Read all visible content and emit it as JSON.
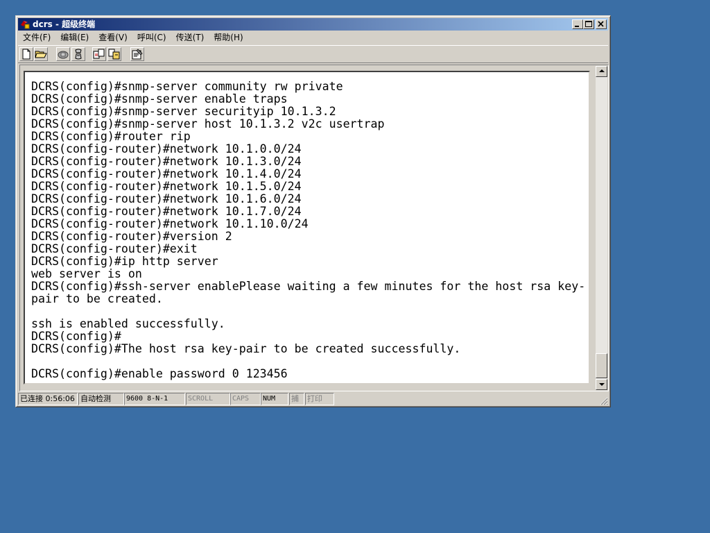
{
  "window": {
    "title": "dcrs - 超级终端"
  },
  "menu": [
    {
      "label": "文件(F)"
    },
    {
      "label": "编辑(E)"
    },
    {
      "label": "查看(V)"
    },
    {
      "label": "呼叫(C)"
    },
    {
      "label": "传送(T)"
    },
    {
      "label": "帮助(H)"
    }
  ],
  "toolbar": [
    {
      "icon": "new-file-icon"
    },
    {
      "icon": "open-folder-icon"
    },
    {
      "icon": "phone-icon"
    },
    {
      "icon": "disconnect-icon"
    },
    {
      "icon": "send-file-icon"
    },
    {
      "icon": "receive-file-icon"
    },
    {
      "icon": "properties-icon"
    }
  ],
  "terminal": {
    "lines": [
      "DCRS(config)#snmp-server community rw private",
      "DCRS(config)#snmp-server enable traps",
      "DCRS(config)#snmp-server securityip 10.1.3.2",
      "DCRS(config)#snmp-server host 10.1.3.2 v2c usertrap",
      "DCRS(config)#router rip",
      "DCRS(config-router)#network 10.1.0.0/24",
      "DCRS(config-router)#network 10.1.3.0/24",
      "DCRS(config-router)#network 10.1.4.0/24",
      "DCRS(config-router)#network 10.1.5.0/24",
      "DCRS(config-router)#network 10.1.6.0/24",
      "DCRS(config-router)#network 10.1.7.0/24",
      "DCRS(config-router)#network 10.1.10.0/24",
      "DCRS(config-router)#version 2",
      "DCRS(config-router)#exit",
      "DCRS(config)#ip http server",
      "web server is on",
      "DCRS(config)#ssh-server enablePlease waiting a few minutes for the host rsa key-",
      "pair to be created.",
      "",
      "ssh is enabled successfully.",
      "DCRS(config)#",
      "DCRS(config)#The host rsa key-pair to be created successfully.",
      "",
      "DCRS(config)#enable password 0 123456"
    ]
  },
  "status": {
    "connected": "已连接 0:56:06",
    "detect": "自动检测",
    "serial": "9600 8-N-1",
    "scroll": "SCROLL",
    "caps": "CAPS",
    "num": "NUM",
    "capture": "捕",
    "print": "打印"
  },
  "colors": {
    "desktop": "#3a6ea5",
    "titlebar_start": "#0a246a",
    "titlebar_end": "#a6caf0",
    "chrome": "#d4d0c8"
  }
}
